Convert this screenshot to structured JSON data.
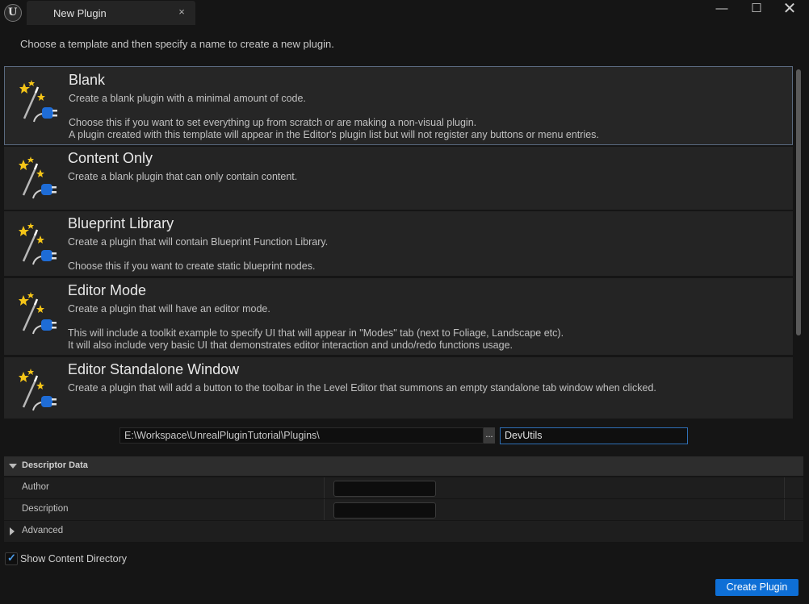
{
  "window": {
    "logo_glyph": "U",
    "tab_title": "New Plugin",
    "tab_close_glyph": "×",
    "minimize_glyph": "—",
    "maximize_glyph": "☐",
    "close_glyph": "✕"
  },
  "instructions": "Choose a template and then specify a name to create a new plugin.",
  "templates": [
    {
      "name": "Blank",
      "lines": [
        "Create a blank plugin with a minimal amount of code.",
        "",
        "Choose this if you want to set everything up from scratch or are making a non-visual plugin.",
        "A plugin created with this template will appear in the Editor's plugin list but will not register any buttons or menu entries."
      ],
      "selected": true
    },
    {
      "name": "Content Only",
      "lines": [
        "Create a blank plugin that can only contain content."
      ],
      "selected": false
    },
    {
      "name": "Blueprint Library",
      "lines": [
        "Create a plugin that will contain Blueprint Function Library.",
        "",
        "Choose this if you want to create static blueprint nodes."
      ],
      "selected": false
    },
    {
      "name": "Editor Mode",
      "lines": [
        "Create a plugin that will have an editor mode.",
        "",
        "This will include a toolkit example to specify UI that will appear in \"Modes\" tab (next to Foliage, Landscape etc).",
        "It will also include very basic UI that demonstrates editor interaction and undo/redo functions usage."
      ],
      "selected": false
    },
    {
      "name": "Editor Standalone Window",
      "lines": [
        "Create a plugin that will add a button to the toolbar in the Level Editor that summons an empty standalone tab window when clicked."
      ],
      "selected": false
    }
  ],
  "path": {
    "value": "E:\\Workspace\\UnrealPluginTutorial\\Plugins\\",
    "browse_label": "..."
  },
  "plugin_name": {
    "value": "DevUtils"
  },
  "descriptor": {
    "header": "Descriptor Data",
    "author_label": "Author",
    "author_value": "",
    "description_label": "Description",
    "description_value": "",
    "advanced_label": "Advanced"
  },
  "show_content_directory": {
    "label": "Show Content Directory",
    "checked": true,
    "check_glyph": "✓"
  },
  "create_button": "Create Plugin",
  "colors": {
    "accent": "#0e6fd6",
    "background": "#151515",
    "panel": "#242424"
  },
  "icons": {
    "template": "magic-wand-plug-icon",
    "expand": "triangle-down-icon",
    "collapse": "triangle-right-icon"
  }
}
